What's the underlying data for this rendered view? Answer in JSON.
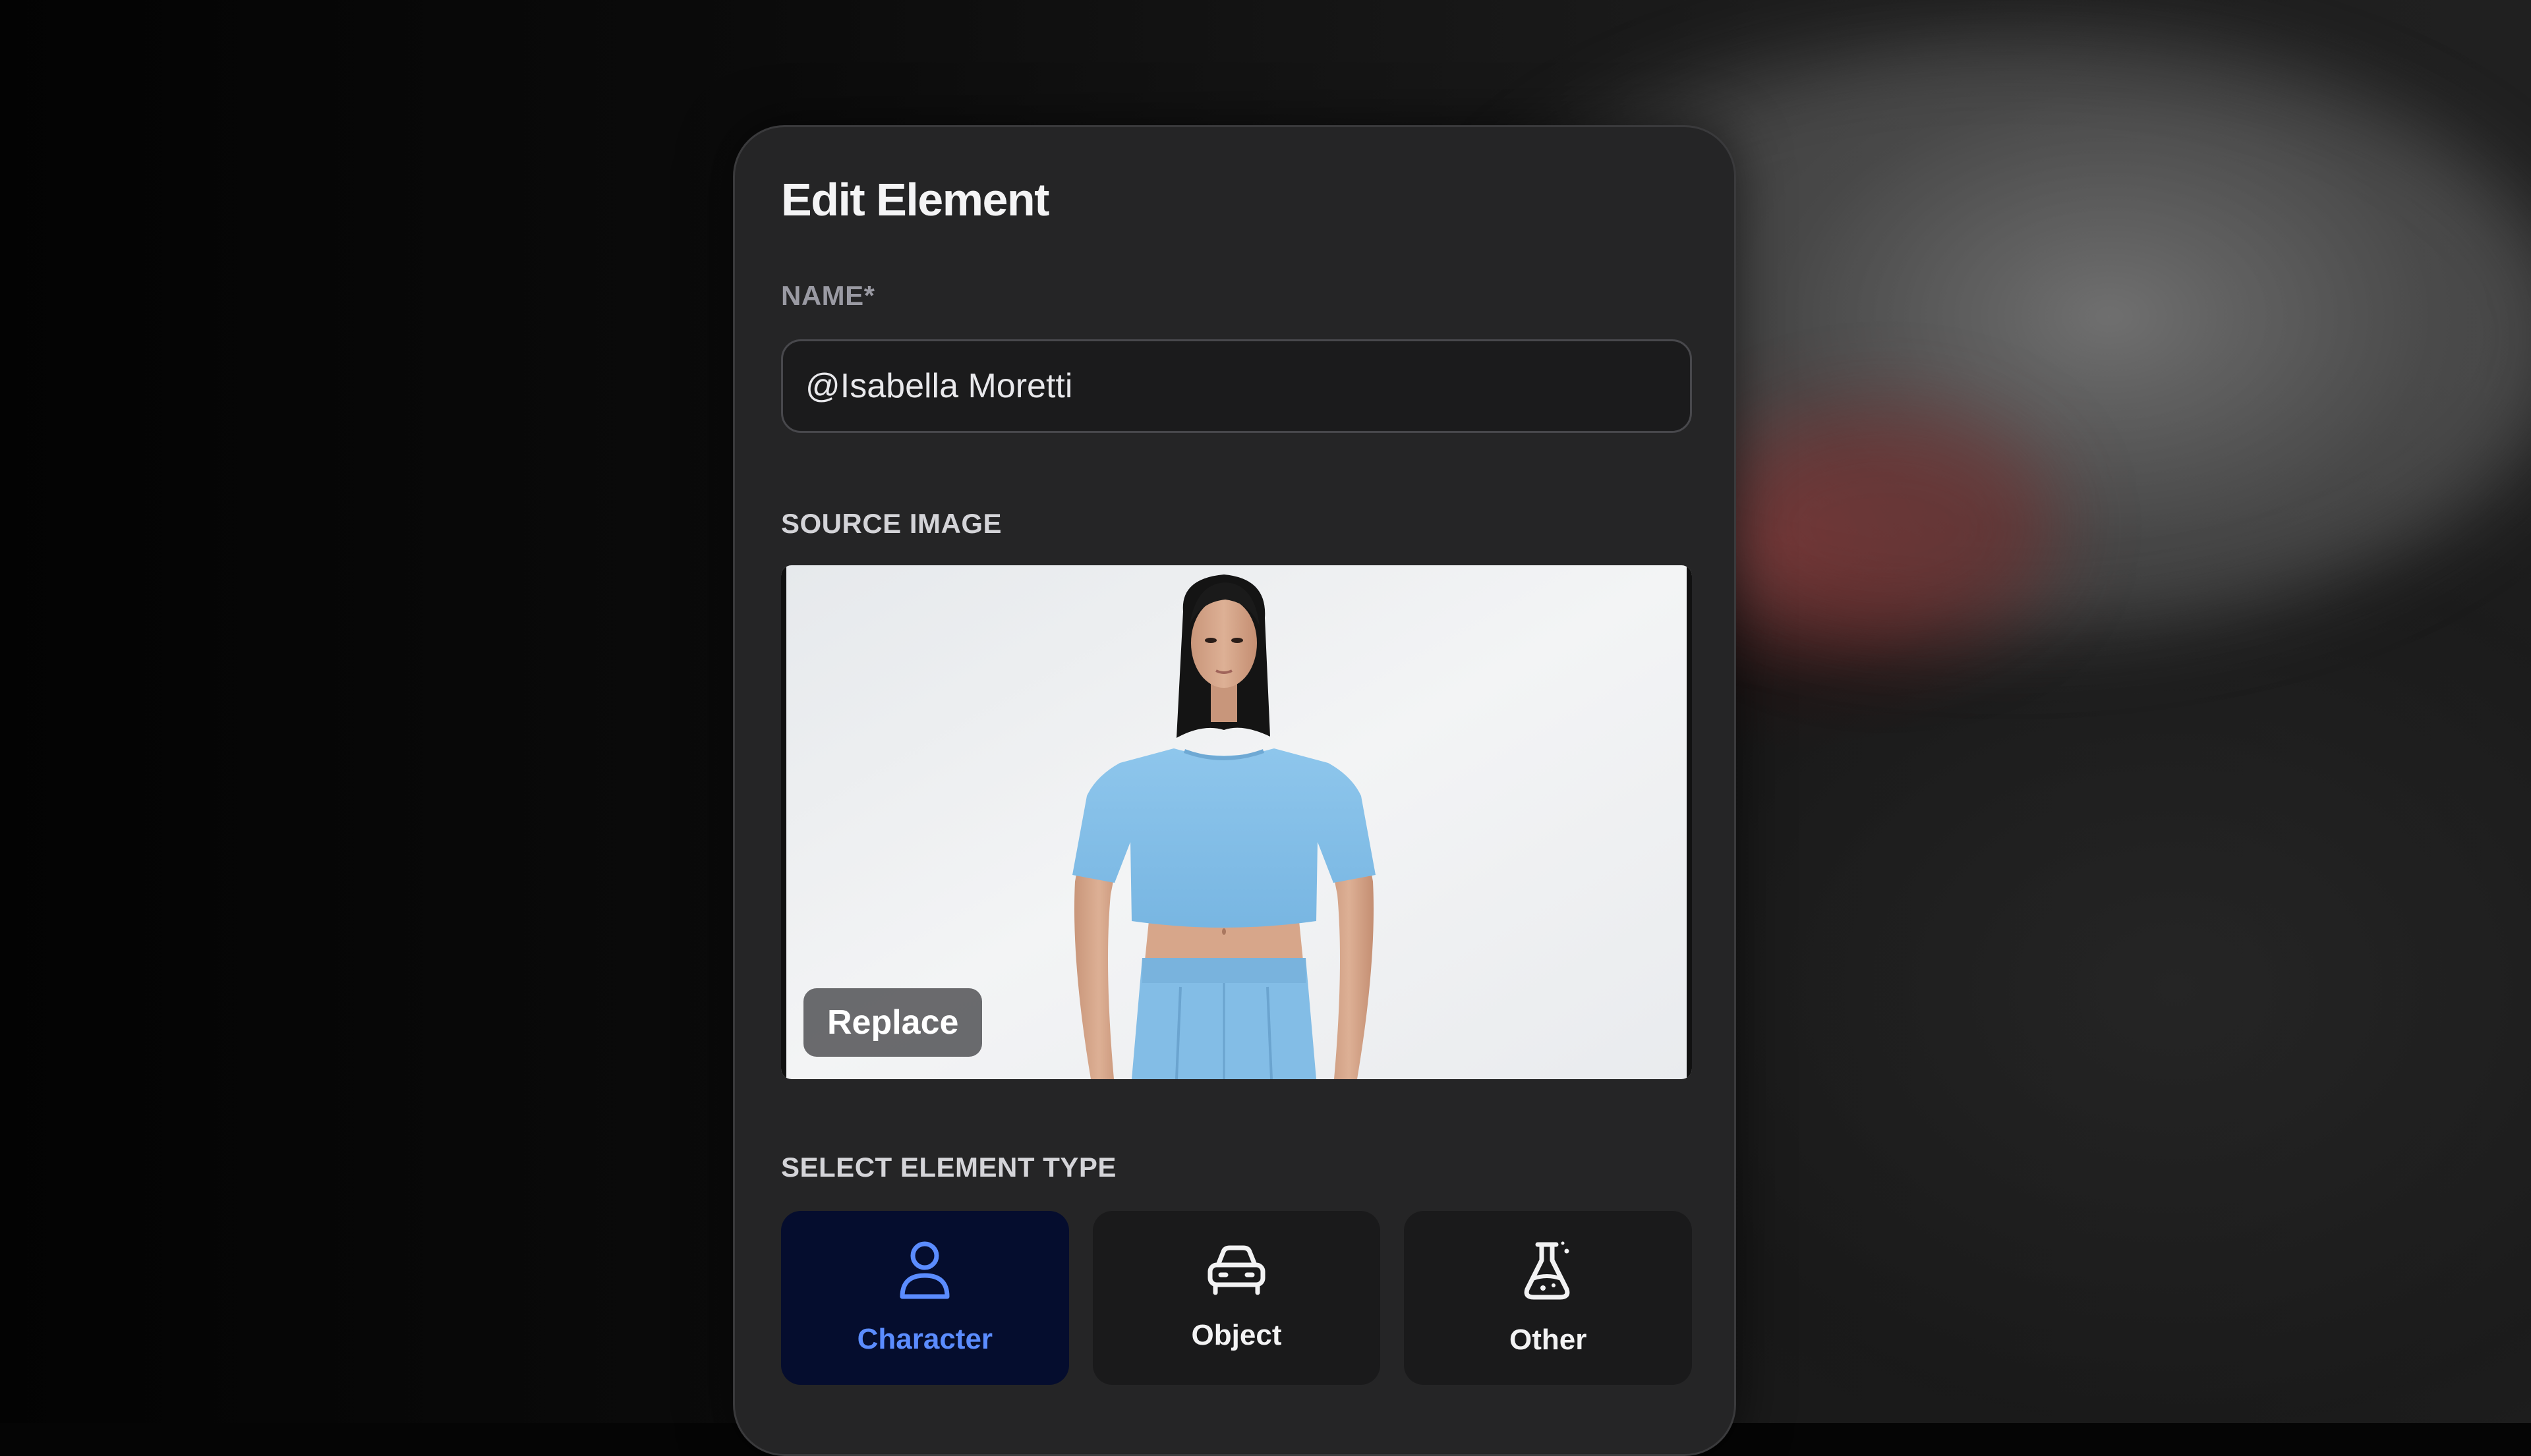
{
  "dialog": {
    "title": "Edit Element"
  },
  "name_field": {
    "label": "NAME*",
    "value": "@Isabella Moretti"
  },
  "source_image": {
    "label": "SOURCE IMAGE",
    "replace_label": "Replace"
  },
  "element_type": {
    "label": "SELECT ELEMENT TYPE",
    "options": [
      {
        "label": "Character",
        "icon": "person-icon",
        "selected": true
      },
      {
        "label": "Object",
        "icon": "car-icon",
        "selected": false
      },
      {
        "label": "Other",
        "icon": "flask-icon",
        "selected": false
      }
    ]
  },
  "colors": {
    "accent": "#5b8cff",
    "selected_card_bg": "#050d2e",
    "panel_bg": "#252526"
  }
}
